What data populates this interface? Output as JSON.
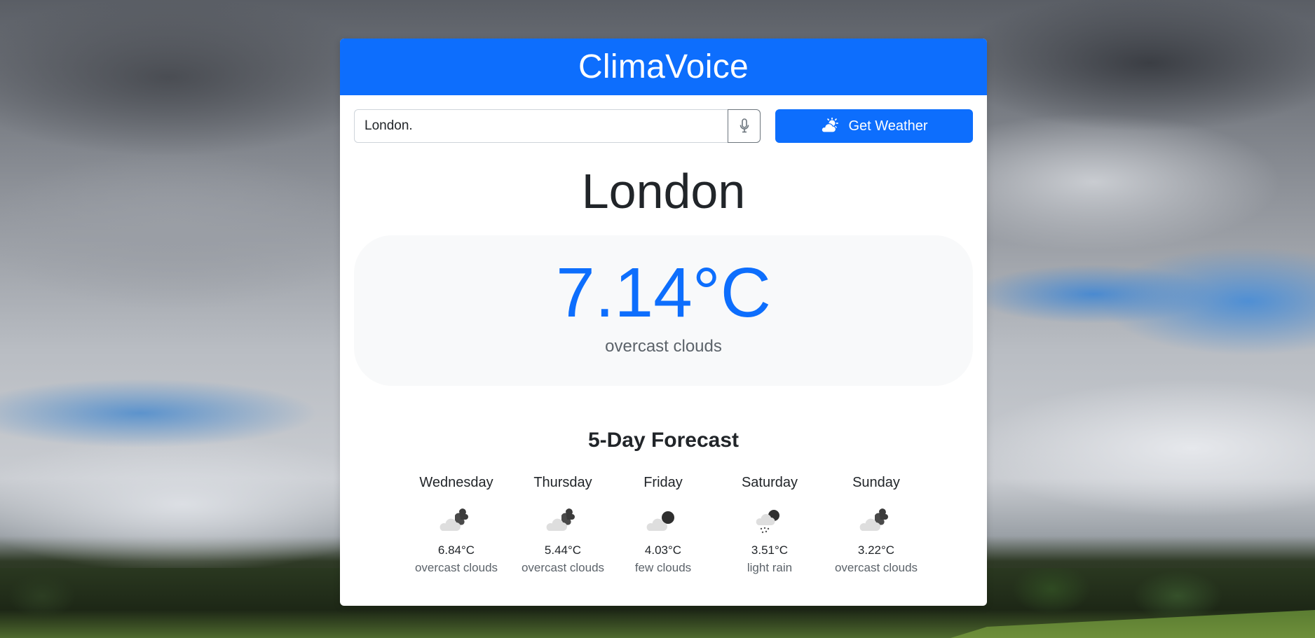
{
  "app": {
    "title": "ClimaVoice"
  },
  "search": {
    "value": "London.",
    "get_weather_label": "Get Weather"
  },
  "current": {
    "city": "London",
    "temperature": "7.14°C",
    "description": "overcast clouds"
  },
  "forecast": {
    "title": "5-Day Forecast",
    "days": [
      {
        "day": "Wednesday",
        "temp": "6.84°C",
        "desc": "overcast clouds",
        "icon": "overcast-clouds-icon"
      },
      {
        "day": "Thursday",
        "temp": "5.44°C",
        "desc": "overcast clouds",
        "icon": "overcast-clouds-icon"
      },
      {
        "day": "Friday",
        "temp": "4.03°C",
        "desc": "few clouds",
        "icon": "few-clouds-icon"
      },
      {
        "day": "Saturday",
        "temp": "3.51°C",
        "desc": "light rain",
        "icon": "light-rain-icon"
      },
      {
        "day": "Sunday",
        "temp": "3.22°C",
        "desc": "overcast clouds",
        "icon": "overcast-clouds-icon"
      }
    ]
  },
  "colors": {
    "primary": "#0d6efd",
    "card": "#ffffff",
    "panel": "#f8f9fa"
  }
}
